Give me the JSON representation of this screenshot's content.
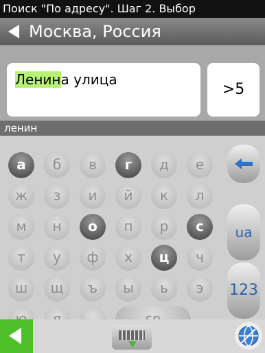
{
  "header": {
    "title": "Поиск \"По адресу\". Шаг 2. Выбор",
    "city": "Москва, Россия"
  },
  "result": {
    "match": "Ленин",
    "rest": "а улица",
    "count": ">5"
  },
  "query": "ленин",
  "keyboard": {
    "rows": [
      [
        "а",
        "б",
        "в",
        "г",
        "д",
        "е"
      ],
      [
        "ж",
        "з",
        "и",
        "й",
        "к",
        "л"
      ],
      [
        "м",
        "н",
        "о",
        "п",
        "р",
        "с"
      ],
      [
        "т",
        "у",
        "ф",
        "х",
        "ц",
        "ч"
      ],
      [
        "ш",
        "щ",
        "ъ",
        "ы",
        "ь",
        "э"
      ],
      [
        "ю",
        "я",
        ".",
        "sp"
      ]
    ],
    "highlighted": [
      "а",
      "г",
      "о",
      "с",
      "ц"
    ],
    "lang_key": "ua",
    "num_key": "123",
    "backspace_icon": "backspace-arrow-icon"
  },
  "bottom": {
    "back_icon": "back-arrow-icon",
    "keyboard_icon": "keyboard-icon",
    "globe_icon": "globe-icon"
  },
  "colors": {
    "accent": "#4fbf2a",
    "highlight": "#b6f075"
  }
}
